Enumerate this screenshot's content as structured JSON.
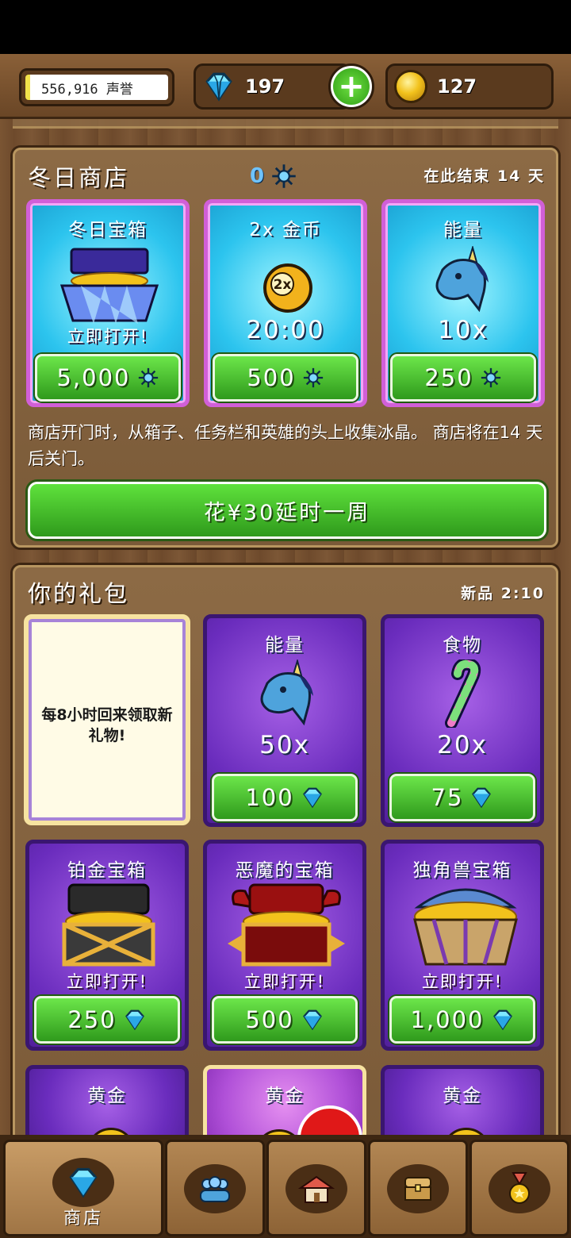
{
  "header": {
    "reputation": "556,916 声誉",
    "gems": "197",
    "coins": "127"
  },
  "winter_shop": {
    "title": "冬日商店",
    "crystal_count": "0",
    "ends_label": "在此结束 14 天",
    "cards": [
      {
        "title": "冬日宝箱",
        "sub": "立即打开!",
        "price": "5,000",
        "icon": "frost-chest-icon"
      },
      {
        "title": "2x 金币",
        "big": "20:00",
        "price": "500",
        "icon": "double-coin-icon"
      },
      {
        "title": "能量",
        "big": "10x",
        "price": "250",
        "icon": "unicorn-icon"
      }
    ],
    "description": "商店开门时，从箱子、任务栏和英雄的头上收集冰晶。 商店将在14 天后关门。",
    "extend_button": "花¥30延时一周"
  },
  "packs": {
    "title": "你的礼包",
    "new_label": "新品 2:10",
    "note": "每8小时回来领取新礼物!",
    "cards": [
      {
        "title": "能量",
        "big": "50x",
        "price": "100",
        "icon": "unicorn-icon"
      },
      {
        "title": "食物",
        "big": "20x",
        "price": "75",
        "icon": "candy-cane-icon"
      },
      {
        "title": "铂金宝箱",
        "sub": "立即打开!",
        "price": "250",
        "icon": "platinum-chest-icon"
      },
      {
        "title": "恶魔的宝箱",
        "sub": "立即打开!",
        "price": "500",
        "icon": "demon-chest-icon"
      },
      {
        "title": "独角兽宝箱",
        "sub": "立即打开!",
        "price": "1,000",
        "icon": "unicorn-chest-icon"
      },
      {
        "title": "黄金",
        "icon": "gold-coin-icon"
      },
      {
        "title": "黄金",
        "icon": "gold-coin-icon"
      },
      {
        "title": "黄金",
        "icon": "gold-coin-icon"
      }
    ]
  },
  "tabs": [
    {
      "label": "商店",
      "icon": "diamond-icon"
    },
    {
      "icon": "heroes-icon"
    },
    {
      "icon": "village-icon"
    },
    {
      "icon": "chest-icon"
    },
    {
      "icon": "medal-icon"
    }
  ]
}
